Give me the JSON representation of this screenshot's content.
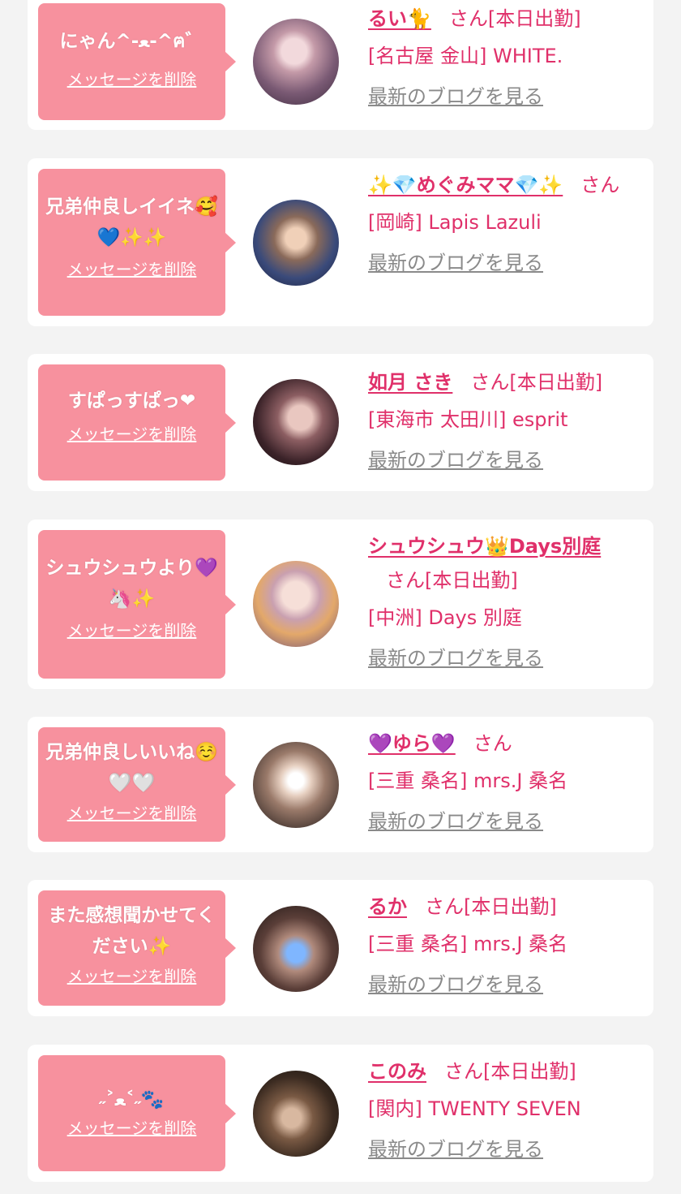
{
  "entries": [
    {
      "message": "にゃん^-ﻌ-^ฅ゛",
      "delete_label": "メッセージを削除",
      "name": "るい🐈",
      "honorific": "さん",
      "status": "[本日出勤]",
      "shop": "[名古屋 金山] WHITE.",
      "blog_link": "最新のブログを見る"
    },
    {
      "message": "兄弟仲良しイイネ🥰💙✨✨",
      "delete_label": "メッセージを削除",
      "name": "✨💎めぐみママ💎✨",
      "honorific": "さん",
      "status": "",
      "shop": "[岡崎] Lapis Lazuli",
      "blog_link": "最新のブログを見る"
    },
    {
      "message": "すぱっすぱっ❤",
      "delete_label": "メッセージを削除",
      "name": "如月 さき",
      "honorific": "さん",
      "status": "[本日出勤]",
      "shop": "[東海市 太田川] esprit",
      "blog_link": "最新のブログを見る"
    },
    {
      "message": "シュウシュウより💜🦄✨",
      "delete_label": "メッセージを削除",
      "name": "シュウシュウ👑Days別庭",
      "honorific": "さん",
      "status": "[本日出勤]",
      "shop": "[中洲] Days 別庭",
      "blog_link": "最新のブログを見る"
    },
    {
      "message": "兄弟仲良しいいね☺️🤍🤍",
      "delete_label": "メッセージを削除",
      "name": "💜ゆら💜",
      "honorific": "さん",
      "status": "",
      "shop": "[三重 桑名] mrs.J 桑名",
      "blog_link": "最新のブログを見る"
    },
    {
      "message": "また感想聞かせてください✨",
      "delete_label": "メッセージを削除",
      "name": "るか",
      "honorific": "さん",
      "status": "[本日出勤]",
      "shop": "[三重 桑名] mrs.J 桑名",
      "blog_link": "最新のブログを見る"
    },
    {
      "message": "˶˃ﻌ˂˶🐾",
      "delete_label": "メッセージを削除",
      "name": "このみ",
      "honorific": "さん",
      "status": "[本日出勤]",
      "shop": "[関内] TWENTY SEVEN",
      "blog_link": "最新のブログを見る"
    }
  ],
  "colors": {
    "accent": "#e0306a",
    "bubble": "#f7919e",
    "background": "#f3f3f3",
    "link_gray": "#8a8a8a"
  }
}
